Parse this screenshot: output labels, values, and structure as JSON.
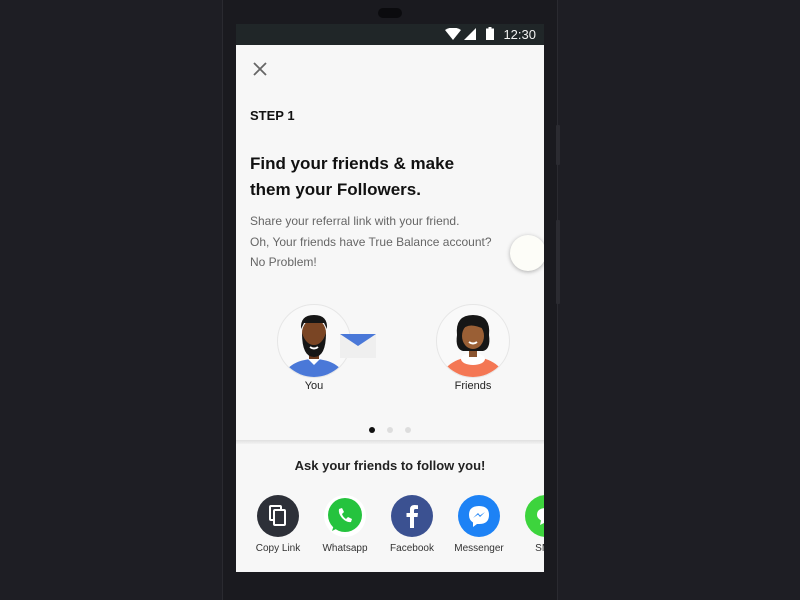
{
  "status_bar": {
    "time": "12:30",
    "icons": [
      "wifi-icon",
      "signal-icon",
      "battery-icon"
    ]
  },
  "header": {
    "close_icon": "close-icon"
  },
  "content": {
    "step": "STEP 1",
    "title": "Find your friends & make them your Followers.",
    "description": [
      "Share your referral link with your friend.",
      "Oh, Your friends have True Balance account?",
      "No Problem!"
    ]
  },
  "illustration": {
    "you_label": "You",
    "friends_label": "Friends"
  },
  "pagination": {
    "total": 3,
    "active": 1
  },
  "share": {
    "title": "Ask your friends to follow you!",
    "items": [
      {
        "label": "Copy Link",
        "icon": "copy-icon",
        "color": "#2d3038"
      },
      {
        "label": "Whatsapp",
        "icon": "whatsapp-icon",
        "color": "#25c33e"
      },
      {
        "label": "Facebook",
        "icon": "facebook-icon",
        "color": "#3b5191"
      },
      {
        "label": "Messenger",
        "icon": "messenger-icon",
        "color": "#1d82f5"
      },
      {
        "label": "SMS",
        "icon": "sms-icon",
        "color": "#3dd43d"
      }
    ]
  }
}
